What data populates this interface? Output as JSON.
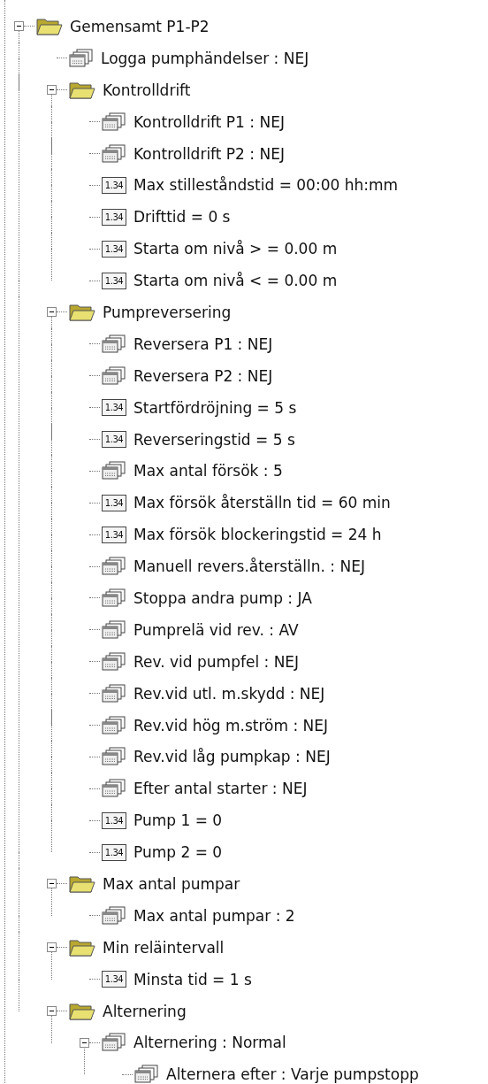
{
  "tree": [
    {
      "kind": "folder",
      "label": "Gemensamt P1-P2",
      "expanded": true,
      "children": [
        {
          "kind": "list",
          "label": "Logga pumphändelser : NEJ"
        },
        {
          "kind": "folder",
          "label": "Kontrolldrift",
          "expanded": true,
          "children": [
            {
              "kind": "list",
              "label": "Kontrolldrift P1 : NEJ"
            },
            {
              "kind": "list",
              "label": "Kontrolldrift P2 : NEJ"
            },
            {
              "kind": "number",
              "badge": "1.34",
              "label": "Max stilleståndstid = 00:00 hh:mm"
            },
            {
              "kind": "number",
              "badge": "1.34",
              "label": "Drifttid = 0 s"
            },
            {
              "kind": "number",
              "badge": "1.34",
              "label": "Starta om nivå > = 0.00 m"
            },
            {
              "kind": "number",
              "badge": "1.34",
              "label": "Starta om nivå < = 0.00 m"
            }
          ]
        },
        {
          "kind": "folder",
          "label": "Pumpreversering",
          "expanded": true,
          "children": [
            {
              "kind": "list",
              "label": "Reversera P1 : NEJ"
            },
            {
              "kind": "list",
              "label": "Reversera P2 : NEJ"
            },
            {
              "kind": "number",
              "badge": "1.34",
              "label": "Startfördröjning = 5 s"
            },
            {
              "kind": "number",
              "badge": "1.34",
              "label": "Reverseringstid = 5 s"
            },
            {
              "kind": "list",
              "label": "Max antal försök : 5"
            },
            {
              "kind": "number",
              "badge": "1.34",
              "label": "Max försök återställn tid = 60 min"
            },
            {
              "kind": "number",
              "badge": "1.34",
              "label": "Max försök blockeringstid = 24 h"
            },
            {
              "kind": "list",
              "label": "Manuell revers.återställn. : NEJ"
            },
            {
              "kind": "list",
              "label": "Stoppa andra pump : JA"
            },
            {
              "kind": "list",
              "label": "Pumprelä vid rev. : AV"
            },
            {
              "kind": "list",
              "label": "Rev. vid pumpfel : NEJ"
            },
            {
              "kind": "list",
              "label": "Rev.vid utl. m.skydd : NEJ"
            },
            {
              "kind": "list",
              "label": "Rev.vid hög m.ström : NEJ"
            },
            {
              "kind": "list",
              "label": "Rev.vid låg pumpkap : NEJ"
            },
            {
              "kind": "list",
              "label": "Efter antal starter : NEJ"
            },
            {
              "kind": "number",
              "badge": "1.34",
              "label": "Pump 1 = 0"
            },
            {
              "kind": "number",
              "badge": "1.34",
              "label": "Pump 2 = 0"
            }
          ]
        },
        {
          "kind": "folder",
          "label": "Max antal pumpar",
          "expanded": true,
          "children": [
            {
              "kind": "list",
              "label": "Max antal pumpar : 2"
            }
          ]
        },
        {
          "kind": "folder",
          "label": "Min reläintervall",
          "expanded": true,
          "children": [
            {
              "kind": "number",
              "badge": "1.34",
              "label": "Minsta tid = 1 s"
            }
          ]
        },
        {
          "kind": "folder",
          "label": "Alternering",
          "expanded": true,
          "children": [
            {
              "kind": "list",
              "label": "Alternering : Normal",
              "expanded": true,
              "children": [
                {
                  "kind": "list",
                  "label": "Alternera efter : Varje pumpstopp"
                }
              ]
            }
          ]
        }
      ]
    }
  ]
}
